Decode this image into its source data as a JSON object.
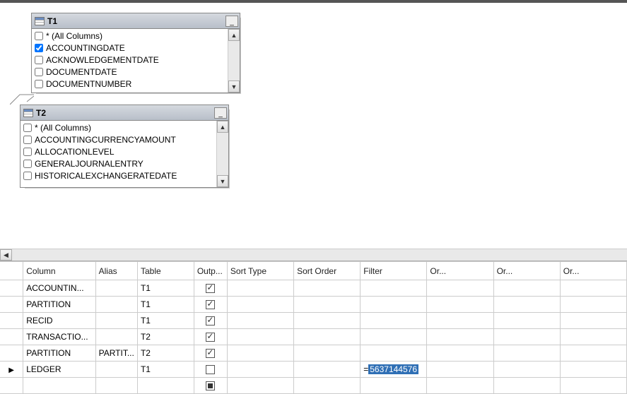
{
  "tables": {
    "t1": {
      "title": "T1",
      "columns": [
        {
          "label": "* (All Columns)",
          "checked": false
        },
        {
          "label": "ACCOUNTINGDATE",
          "checked": true
        },
        {
          "label": "ACKNOWLEDGEMENTDATE",
          "checked": false
        },
        {
          "label": "DOCUMENTDATE",
          "checked": false
        },
        {
          "label": "DOCUMENTNUMBER",
          "checked": false
        }
      ]
    },
    "t2": {
      "title": "T2",
      "columns": [
        {
          "label": "* (All Columns)",
          "checked": false
        },
        {
          "label": "ACCOUNTINGCURRENCYAMOUNT",
          "checked": false
        },
        {
          "label": "ALLOCATIONLEVEL",
          "checked": false
        },
        {
          "label": "GENERALJOURNALENTRY",
          "checked": false
        },
        {
          "label": "HISTORICALEXCHANGERATEDATE",
          "checked": false
        }
      ]
    }
  },
  "grid": {
    "headers": {
      "column": "Column",
      "alias": "Alias",
      "table": "Table",
      "output": "Outp...",
      "sort_type": "Sort Type",
      "sort_order": "Sort Order",
      "filter": "Filter",
      "or1": "Or...",
      "or2": "Or...",
      "or3": "Or..."
    },
    "rows": [
      {
        "column": "ACCOUNTIN...",
        "alias": "",
        "table": "T1",
        "output": "checked",
        "sort_type": "",
        "sort_order": "",
        "filter": "",
        "show_arrow": false
      },
      {
        "column": "PARTITION",
        "alias": "",
        "table": "T1",
        "output": "checked",
        "sort_type": "",
        "sort_order": "",
        "filter": "",
        "show_arrow": false
      },
      {
        "column": "RECID",
        "alias": "",
        "table": "T1",
        "output": "checked",
        "sort_type": "",
        "sort_order": "",
        "filter": "",
        "show_arrow": false
      },
      {
        "column": "TRANSACTIO...",
        "alias": "",
        "table": "T2",
        "output": "checked",
        "sort_type": "",
        "sort_order": "",
        "filter": "",
        "show_arrow": false
      },
      {
        "column": "PARTITION",
        "alias": "PARTIT...",
        "table": "T2",
        "output": "checked",
        "sort_type": "",
        "sort_order": "",
        "filter": "",
        "show_arrow": false
      },
      {
        "column": "LEDGER",
        "alias": "",
        "table": "T1",
        "output": "unchecked",
        "sort_type": "",
        "sort_order": "",
        "filter_prefix": "= ",
        "filter_value": "5637144576",
        "show_arrow": true
      }
    ],
    "trailing": {
      "output": "square"
    }
  }
}
